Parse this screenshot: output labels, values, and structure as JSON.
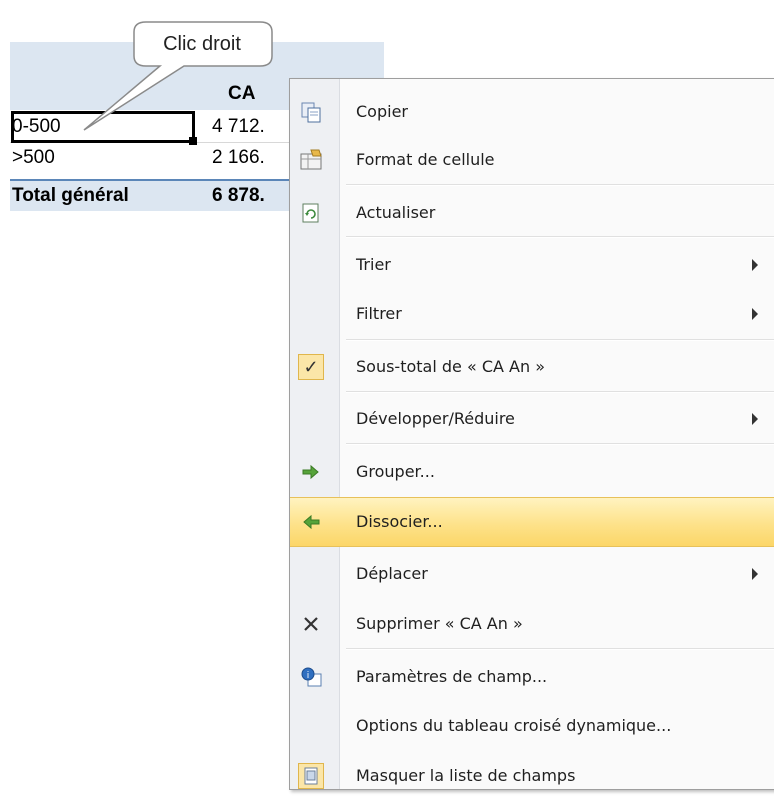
{
  "callout": {
    "text": "Clic droit"
  },
  "table": {
    "header": "CA",
    "rows": [
      {
        "label": "0-500",
        "value": "4 712."
      },
      {
        "label": ">500",
        "value": "2 166."
      },
      {
        "label": "Total général",
        "value": "6 878."
      }
    ]
  },
  "menu": {
    "items": [
      {
        "label": "Copier",
        "icon": "copy-icon"
      },
      {
        "label": "Format de cellule",
        "icon": "format-cells-icon"
      },
      {
        "label": "Actualiser",
        "icon": "refresh-icon"
      },
      {
        "label": "Trier",
        "submenu": true
      },
      {
        "label": "Filtrer",
        "submenu": true
      },
      {
        "label": "Sous-total de « CA An »",
        "checked": true
      },
      {
        "label": "Développer/Réduire",
        "submenu": true
      },
      {
        "label": "Grouper...",
        "icon": "group-arrow-icon"
      },
      {
        "label": "Dissocier...",
        "icon": "ungroup-arrow-icon",
        "highlighted": true
      },
      {
        "label": "Déplacer",
        "submenu": true
      },
      {
        "label": "Supprimer « CA An »",
        "icon": "delete-x-icon"
      },
      {
        "label": "Paramètres de champ...",
        "icon": "field-settings-icon"
      },
      {
        "label": "Options du tableau croisé dynamique..."
      },
      {
        "label": "Masquer la liste de champs",
        "icon": "field-list-icon"
      }
    ],
    "highlight_color": "#fde28a"
  }
}
